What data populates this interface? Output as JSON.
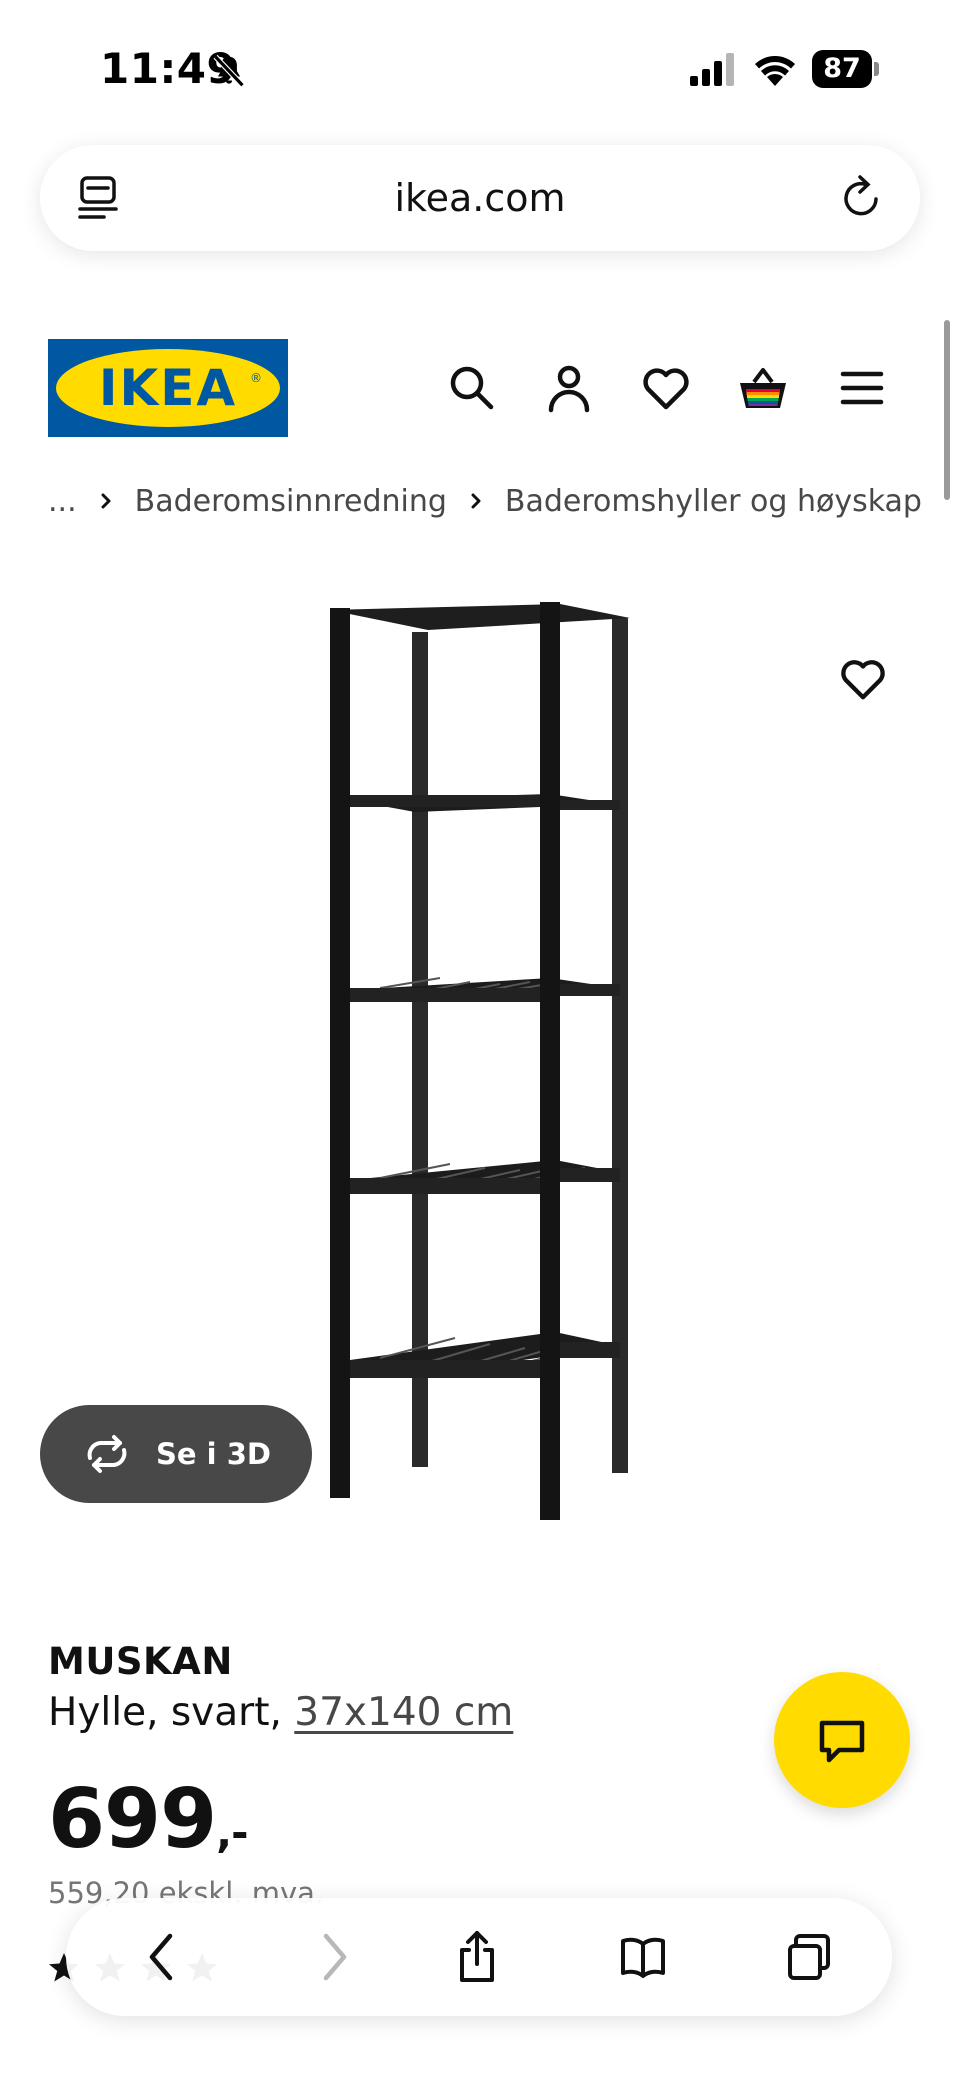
{
  "status_bar": {
    "time": "11:49",
    "battery": "87"
  },
  "browser": {
    "url": "ikea.com"
  },
  "header": {
    "logo_text": "IKEA",
    "icons": [
      "search-icon",
      "profile-icon",
      "heart-icon",
      "basket-icon",
      "menu-icon"
    ]
  },
  "breadcrumb": {
    "ellipsis": "...",
    "items": [
      "Baderomsinnredning",
      "Baderomshyller og høyskap"
    ]
  },
  "product": {
    "view_3d_label": "Se i 3D",
    "name": "MUSKAN",
    "description": "Hylle, svart,",
    "size": "37x140 cm",
    "price": "699",
    "price_suffix": ",-",
    "price_ex_vat": "559,20 ekskl. mva."
  },
  "colors": {
    "brand_blue": "#0058a3",
    "brand_yellow": "#ffdb00",
    "button_dark": "#484848"
  }
}
